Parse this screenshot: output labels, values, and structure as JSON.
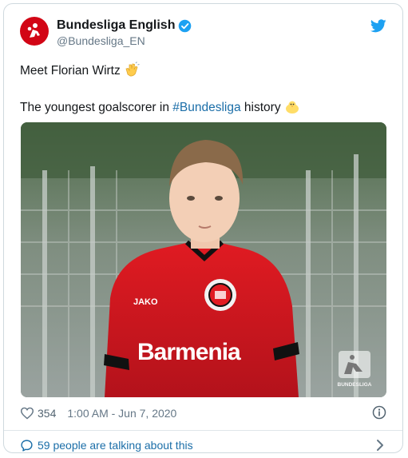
{
  "tweet": {
    "author": {
      "display_name": "Bundesliga English",
      "handle": "@Bundesliga_EN",
      "verified": true
    },
    "text_line1": "Meet Florian Wirtz",
    "text_line2_prefix": "The youngest goalscorer in ",
    "hashtag": "#Bundesliga",
    "text_line2_suffix": " history",
    "media": {
      "jersey_sponsor": "Barmenia",
      "kit_brand": "JAKO",
      "watermark": "BUNDESLIGA"
    },
    "likes": "354",
    "timestamp": "1:00 AM - Jun 7, 2020",
    "conversation_link": "59 people are talking about this"
  },
  "icons": {
    "logo": "bundesliga-logo-icon",
    "verified": "verified-badge-icon",
    "platform": "twitter-bird-icon",
    "emoji1": "clapping-hands-emoji",
    "emoji2": "baby-chick-emoji",
    "like": "heart-icon",
    "info": "info-icon",
    "reply": "speech-bubble-icon",
    "more": "chevron-right-icon"
  },
  "colors": {
    "brand_red": "#d20515",
    "link_blue": "#1b6ea8",
    "twitter_blue": "#1da1f2",
    "muted_text": "#657786",
    "border": "#cfd9de"
  }
}
